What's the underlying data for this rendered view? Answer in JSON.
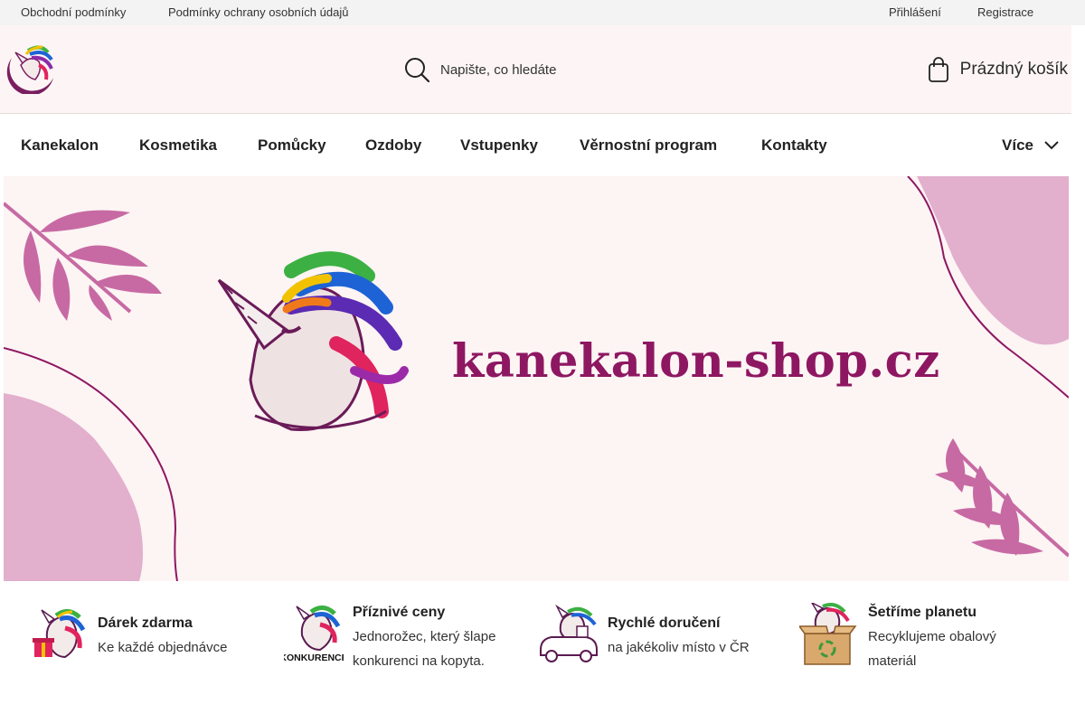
{
  "topbar": {
    "links": [
      "Obchodní podmínky",
      "Podmínky ochrany osobních údajů"
    ],
    "login": "Přihlášení",
    "register": "Registrace"
  },
  "header": {
    "search_placeholder": "Napište, co hledáte",
    "cart_label": "Prázdný košík"
  },
  "nav": {
    "items": [
      "Kanekalon",
      "Kosmetika",
      "Pomůcky",
      "Ozdoby",
      "Vstupenky",
      "Věrnostní program",
      "Kontakty"
    ],
    "more_label": "Více"
  },
  "hero": {
    "brand_text": "kanekalon-shop.cz"
  },
  "features": [
    {
      "title": "Dárek zdarma",
      "desc": "Ke každé objednávce",
      "icon": "unicorn-gift-icon"
    },
    {
      "title": "Příznivé ceny",
      "desc": "Jednorožec, který šlape konkurenci na kopyta.",
      "icon": "unicorn-konkurence-icon",
      "icon_text": "KONKURENCE"
    },
    {
      "title": "Rychlé doručení",
      "desc": "na jakékoliv místo v ČR",
      "icon": "unicorn-delivery-car-icon"
    },
    {
      "title": "Šetříme planetu",
      "desc": "Recyklujeme obalový materiál",
      "icon": "unicorn-recycle-box-icon"
    }
  ],
  "colors": {
    "brand": "#8e1762",
    "header_bg": "#fdf5f5",
    "hero_bg": "#fdf4f4",
    "decor_pink": "#c76aa3",
    "decor_light": "#e2afcd"
  }
}
